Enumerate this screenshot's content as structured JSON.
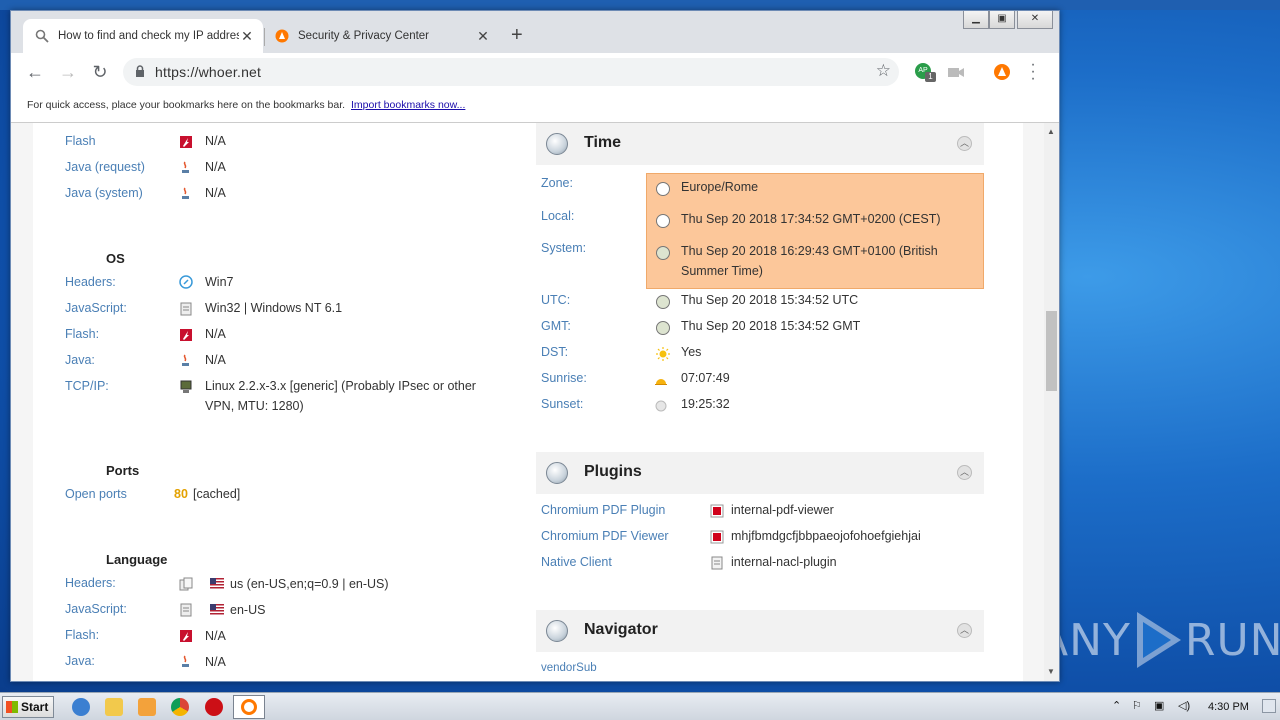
{
  "browser": {
    "tabs": [
      {
        "title": "How to find and check my IP address",
        "active": true
      },
      {
        "title": "Security & Privacy Center",
        "active": false
      }
    ],
    "url": "https://whoer.net",
    "bookmark_hint": "For quick access, place your bookmarks here on the bookmarks bar.",
    "bookmark_link": "Import bookmarks now...",
    "profile_badge": "1",
    "profile_initials": "AP"
  },
  "left": {
    "top_rows": [
      {
        "label": "Flash",
        "value": "N/A"
      },
      {
        "label": "Java (request)",
        "value": "N/A"
      },
      {
        "label": "Java (system)",
        "value": "N/A"
      }
    ],
    "os": {
      "title": "OS",
      "rows": [
        {
          "label": "Headers:",
          "value": "Win7"
        },
        {
          "label": "JavaScript:",
          "value": "Win32 | Windows NT 6.1"
        },
        {
          "label": "Flash:",
          "value": "N/A"
        },
        {
          "label": "Java:",
          "value": "N/A"
        },
        {
          "label": "TCP/IP:",
          "value_line1": "Linux 2.2.x-3.x [generic] (Probably IPsec or other",
          "value_line2": "VPN, MTU: 1280)"
        }
      ]
    },
    "ports": {
      "title": "Ports",
      "label": "Open ports",
      "port": "80",
      "note": "[cached]"
    },
    "language": {
      "title": "Language",
      "rows": [
        {
          "label": "Headers:",
          "value": "us (en-US,en;q=0.9 | en-US)"
        },
        {
          "label": "JavaScript:",
          "value": "en-US"
        },
        {
          "label": "Flash:",
          "value": "N/A"
        },
        {
          "label": "Java:",
          "value": "N/A"
        }
      ]
    }
  },
  "time": {
    "title": "Time",
    "zone_label": "Zone:",
    "zone": "Europe/Rome",
    "local_label": "Local:",
    "local": "Thu Sep 20 2018 17:34:52 GMT+0200 (CEST)",
    "system_label": "System:",
    "system_line1": "Thu Sep 20 2018 16:29:43 GMT+0100 (British",
    "system_line2": "Summer Time)",
    "utc_label": "UTC:",
    "utc": "Thu Sep 20 2018 15:34:52 UTC",
    "gmt_label": "GMT:",
    "gmt": "Thu Sep 20 2018 15:34:52 GMT",
    "dst_label": "DST:",
    "dst": "Yes",
    "sunrise_label": "Sunrise:",
    "sunrise": "07:07:49",
    "sunset_label": "Sunset:",
    "sunset": "19:25:32",
    "highlight_color": "#fcc79a"
  },
  "plugins": {
    "title": "Plugins",
    "rows": [
      {
        "label": "Chromium PDF Plugin",
        "value": "internal-pdf-viewer"
      },
      {
        "label": "Chromium PDF Viewer",
        "value": "mhjfbmdgcfjbbpaeojofohoefgiehjai"
      },
      {
        "label": "Native Client",
        "value": "internal-nacl-plugin"
      }
    ]
  },
  "navigator": {
    "title": "Navigator",
    "first_label": "vendorSub"
  },
  "taskbar": {
    "start": "Start",
    "clock": "4:30 PM"
  },
  "watermark": {
    "left": "ANY",
    "right": "RUN"
  }
}
